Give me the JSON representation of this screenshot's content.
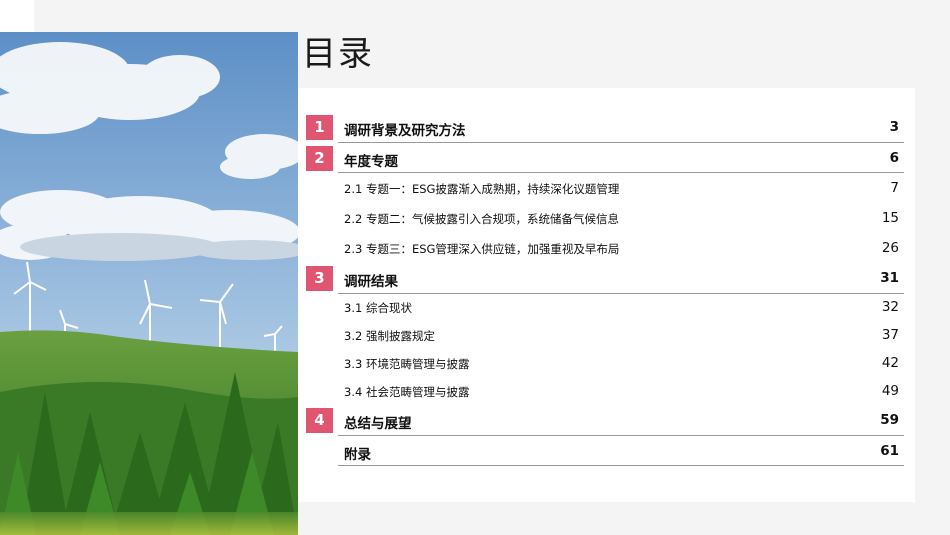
{
  "title": "目录",
  "toc": [
    {
      "type": "main",
      "num": "1",
      "label": "调研背景及研究方法",
      "page": "3"
    },
    {
      "type": "main",
      "num": "2",
      "label": "年度专题",
      "page": "6"
    },
    {
      "type": "sub",
      "label": "2.1 专题一：ESG披露渐入成熟期，持续深化议题管理",
      "page": "7"
    },
    {
      "type": "sub",
      "label": "2.2 专题二：气候披露引入合规项，系统储备气候信息",
      "page": "15"
    },
    {
      "type": "sub",
      "label": "2.3 专题三：ESG管理深入供应链，加强重视及早布局",
      "page": "26"
    },
    {
      "type": "main",
      "num": "3",
      "label": "调研结果",
      "page": "31"
    },
    {
      "type": "sub",
      "label": "3.1 综合现状",
      "page": "32"
    },
    {
      "type": "sub",
      "label": "3.2 强制披露规定",
      "page": "37"
    },
    {
      "type": "sub",
      "label": "3.3 环境范畴管理与披露",
      "page": "42"
    },
    {
      "type": "sub",
      "label": "3.4 社会范畴管理与披露",
      "page": "49"
    },
    {
      "type": "main",
      "num": "4",
      "label": "总结与展望",
      "page": "59"
    },
    {
      "type": "main",
      "num": "",
      "label": "附录",
      "page": "61"
    }
  ],
  "colors": {
    "accent": "#e05570",
    "sky": "#6f9fcf",
    "forest": "#3f7f2c"
  }
}
